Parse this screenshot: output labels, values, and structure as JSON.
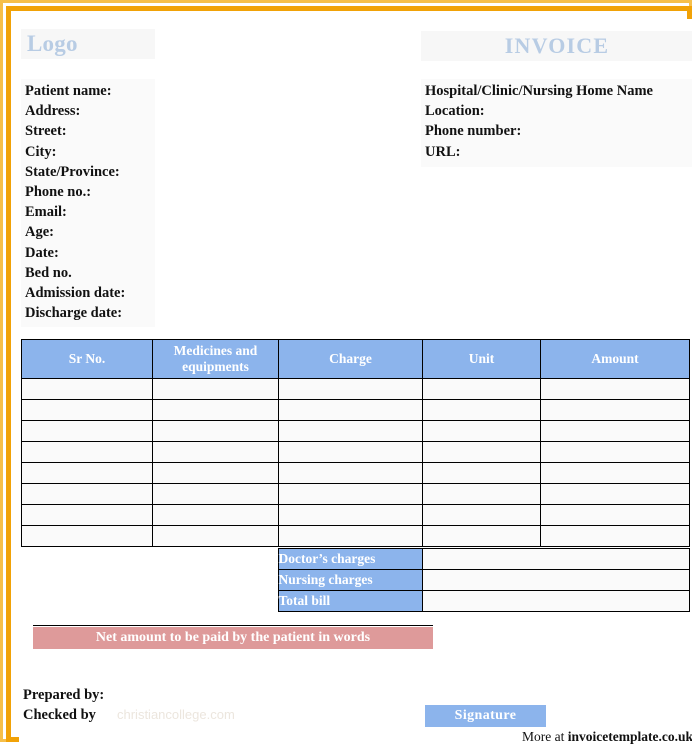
{
  "header": {
    "logo_label": "Logo",
    "invoice_label": "INVOICE"
  },
  "patient_info": {
    "lines": [
      "Patient name:",
      "Address:",
      "Street:",
      "City:",
      "State/Province:",
      "Phone no.:",
      "Email:",
      "Age:",
      "Date:",
      "Bed no.",
      "Admission date:",
      "Discharge date:"
    ]
  },
  "hospital_info": {
    "lines": [
      "Hospital/Clinic/Nursing Home Name",
      "Location:",
      "Phone number:",
      "URL:"
    ]
  },
  "bill_table": {
    "columns": [
      "Sr No.",
      "Medicines and equipments",
      "Charge",
      "Unit",
      "Amount"
    ],
    "rows": [
      [
        "",
        "",
        "",
        "",
        ""
      ],
      [
        "",
        "",
        "",
        "",
        ""
      ],
      [
        "",
        "",
        "",
        "",
        ""
      ],
      [
        "",
        "",
        "",
        "",
        ""
      ],
      [
        "",
        "",
        "",
        "",
        ""
      ],
      [
        "",
        "",
        "",
        "",
        ""
      ],
      [
        "",
        "",
        "",
        "",
        ""
      ],
      [
        "",
        "",
        "",
        "",
        ""
      ]
    ]
  },
  "summary": {
    "rows": [
      {
        "label": "Doctor’s charges",
        "value": ""
      },
      {
        "label": "Nursing charges",
        "value": ""
      },
      {
        "label": "Total bill",
        "value": ""
      }
    ]
  },
  "net_amount": {
    "label": "Net amount to be paid by the patient in words",
    "value": ""
  },
  "footer": {
    "prepared_by": "Prepared by:",
    "checked_by": "Checked by",
    "signature_label": "Signature",
    "watermark": "christiancollege.com",
    "attribution_prefix": "More at ",
    "attribution_site": "invoicetemplate.co.uk"
  },
  "colors": {
    "border_outer": "#f6bf4a",
    "border_inner": "#f1a207",
    "table_header_blue": "#8cb4ec",
    "net_bar_pink": "#de9a9a",
    "logo_blue": "#b8cce4"
  }
}
